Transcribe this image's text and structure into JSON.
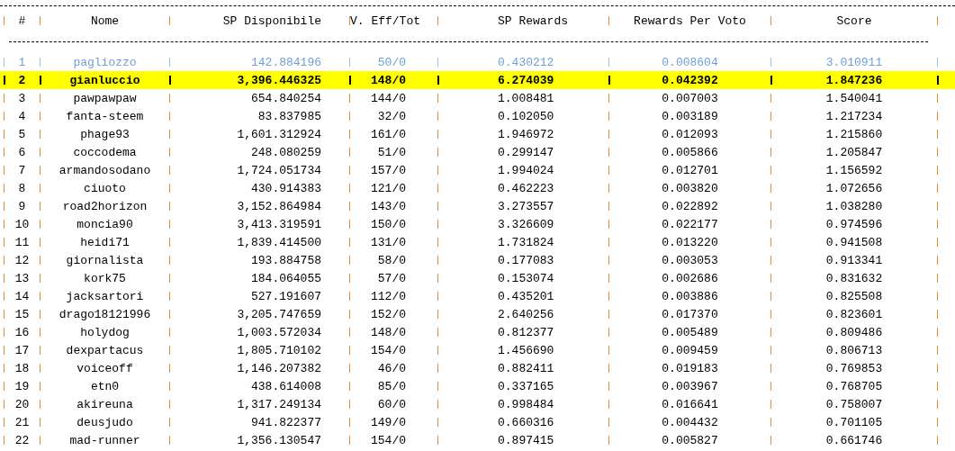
{
  "table": {
    "columns": [
      "#",
      "Nome",
      "SP Disponibile",
      "V. Eff/Tot",
      "SP Rewards",
      "Rewards Per Voto",
      "Score"
    ],
    "rows": [
      {
        "kind": "muted",
        "cells": [
          "1",
          "pagliozzo",
          "142.884196",
          "50/0",
          "0.430212",
          "0.008604",
          "3.010911"
        ]
      },
      {
        "kind": "highlight",
        "cells": [
          "2",
          "gianluccio",
          "3,396.446325",
          "148/0",
          "6.274039",
          "0.042392",
          "1.847236"
        ]
      },
      {
        "kind": "normal",
        "cells": [
          "3",
          "pawpawpaw",
          "654.840254",
          "144/0",
          "1.008481",
          "0.007003",
          "1.540041"
        ]
      },
      {
        "kind": "normal",
        "cells": [
          "4",
          "fanta-steem",
          "83.837985",
          "32/0",
          "0.102050",
          "0.003189",
          "1.217234"
        ]
      },
      {
        "kind": "normal",
        "cells": [
          "5",
          "phage93",
          "1,601.312924",
          "161/0",
          "1.946972",
          "0.012093",
          "1.215860"
        ]
      },
      {
        "kind": "normal",
        "cells": [
          "6",
          "coccodema",
          "248.080259",
          "51/0",
          "0.299147",
          "0.005866",
          "1.205847"
        ]
      },
      {
        "kind": "normal",
        "cells": [
          "7",
          "armandosodano",
          "1,724.051734",
          "157/0",
          "1.994024",
          "0.012701",
          "1.156592"
        ]
      },
      {
        "kind": "normal",
        "cells": [
          "8",
          "ciuoto",
          "430.914383",
          "121/0",
          "0.462223",
          "0.003820",
          "1.072656"
        ]
      },
      {
        "kind": "normal",
        "cells": [
          "9",
          "road2horizon",
          "3,152.864984",
          "143/0",
          "3.273557",
          "0.022892",
          "1.038280"
        ]
      },
      {
        "kind": "normal",
        "cells": [
          "10",
          "moncia90",
          "3,413.319591",
          "150/0",
          "3.326609",
          "0.022177",
          "0.974596"
        ]
      },
      {
        "kind": "normal",
        "cells": [
          "11",
          "heidi71",
          "1,839.414500",
          "131/0",
          "1.731824",
          "0.013220",
          "0.941508"
        ]
      },
      {
        "kind": "normal",
        "cells": [
          "12",
          "giornalista",
          "193.884758",
          "58/0",
          "0.177083",
          "0.003053",
          "0.913341"
        ]
      },
      {
        "kind": "normal",
        "cells": [
          "13",
          "kork75",
          "184.064055",
          "57/0",
          "0.153074",
          "0.002686",
          "0.831632"
        ]
      },
      {
        "kind": "normal",
        "cells": [
          "14",
          "jacksartori",
          "527.191607",
          "112/0",
          "0.435201",
          "0.003886",
          "0.825508"
        ]
      },
      {
        "kind": "normal",
        "cells": [
          "15",
          "drago18121996",
          "3,205.747659",
          "152/0",
          "2.640256",
          "0.017370",
          "0.823601"
        ]
      },
      {
        "kind": "normal",
        "cells": [
          "16",
          "holydog",
          "1,003.572034",
          "148/0",
          "0.812377",
          "0.005489",
          "0.809486"
        ]
      },
      {
        "kind": "normal",
        "cells": [
          "17",
          "dexpartacus",
          "1,805.710102",
          "154/0",
          "1.456690",
          "0.009459",
          "0.806713"
        ]
      },
      {
        "kind": "normal",
        "cells": [
          "18",
          "voiceoff",
          "1,146.207382",
          "46/0",
          "0.882411",
          "0.019183",
          "0.769853"
        ]
      },
      {
        "kind": "normal",
        "cells": [
          "19",
          "etn0",
          "438.614008",
          "85/0",
          "0.337165",
          "0.003967",
          "0.768705"
        ]
      },
      {
        "kind": "normal",
        "cells": [
          "20",
          "akireuna",
          "1,317.249134",
          "60/0",
          "0.998484",
          "0.016641",
          "0.758007"
        ]
      },
      {
        "kind": "normal",
        "cells": [
          "21",
          "deusjudo",
          "941.822377",
          "149/0",
          "0.660316",
          "0.004432",
          "0.701105"
        ]
      },
      {
        "kind": "normal",
        "cells": [
          "22",
          "mad-runner",
          "1,356.130547",
          "154/0",
          "0.897415",
          "0.005827",
          "0.661746"
        ]
      }
    ]
  }
}
